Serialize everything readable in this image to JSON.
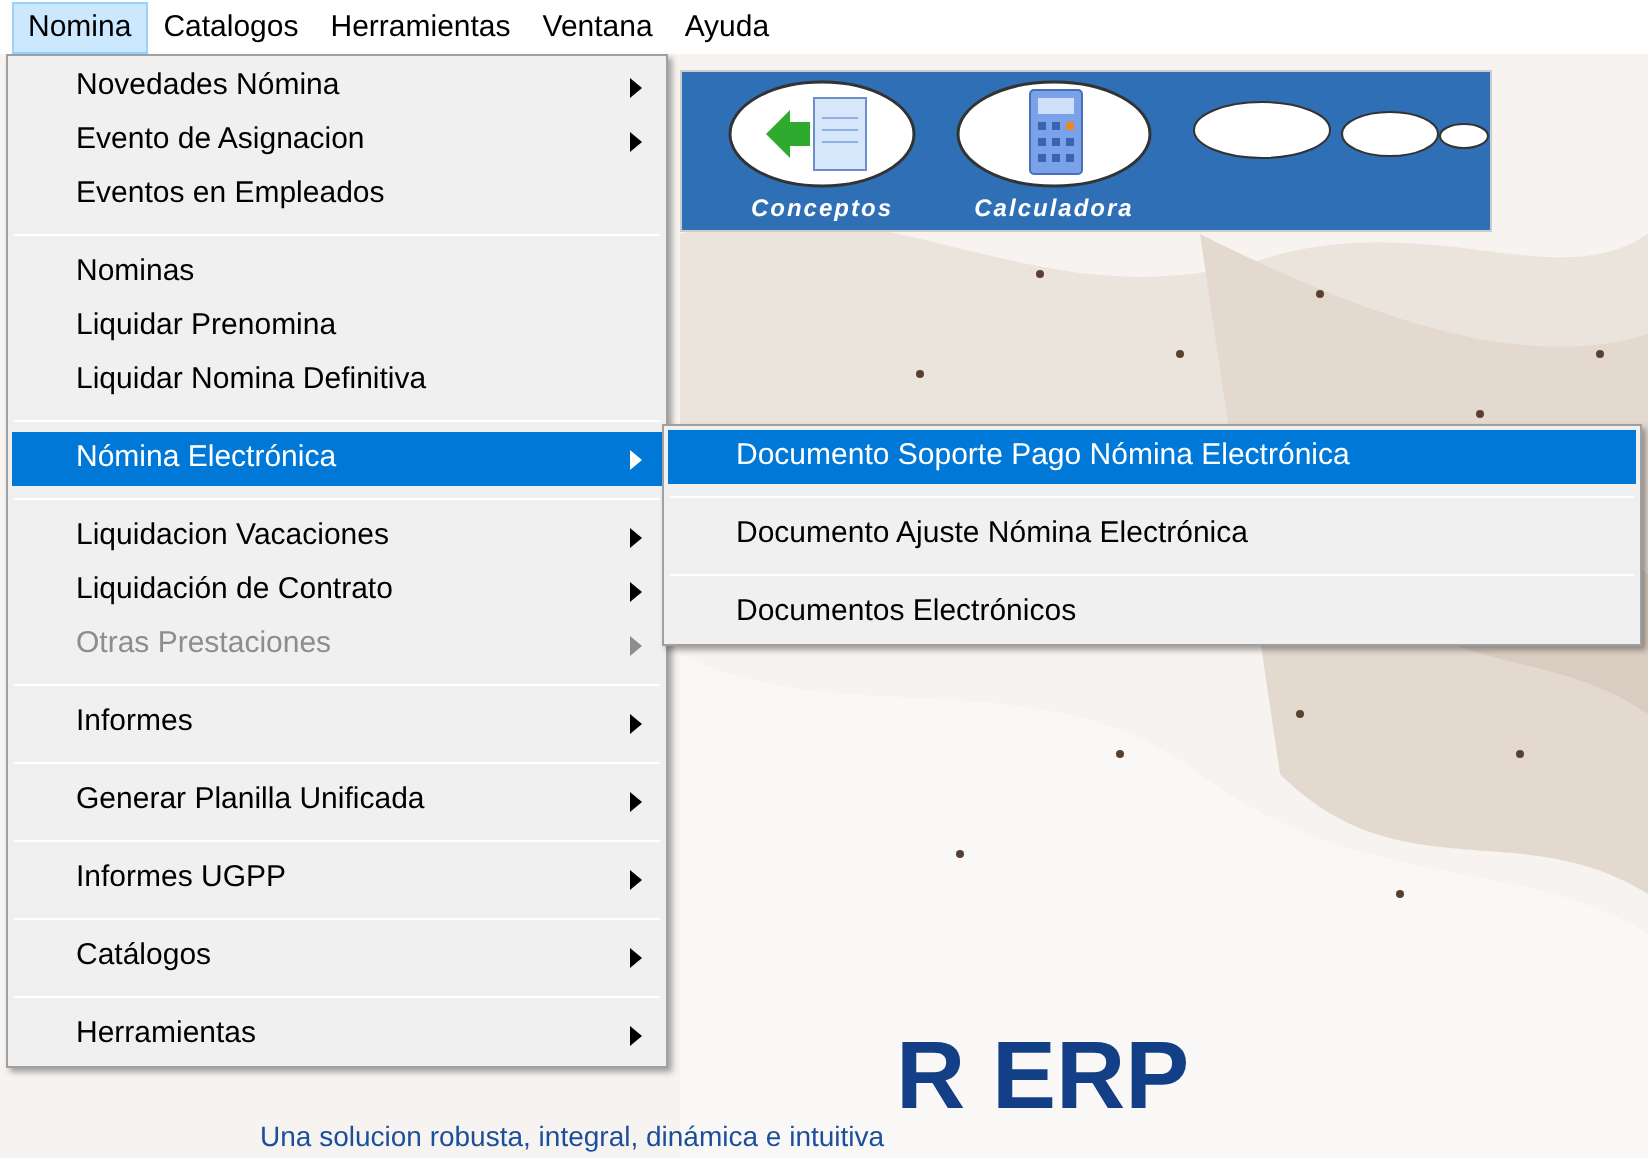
{
  "menubar": [
    {
      "label": "Nomina",
      "selected": true
    },
    {
      "label": "Catalogos",
      "selected": false
    },
    {
      "label": "Herramientas",
      "selected": false
    },
    {
      "label": "Ventana",
      "selected": false
    },
    {
      "label": "Ayuda",
      "selected": false
    }
  ],
  "toolbar": {
    "buttons": [
      {
        "label": "Conceptos",
        "kind": "concepts"
      },
      {
        "label": "Calculadora",
        "kind": "calculator"
      },
      {
        "kind": "blank"
      }
    ]
  },
  "menu": {
    "items": [
      {
        "kind": "item",
        "label": "Novedades Nómina",
        "submenu": true,
        "selected": false,
        "disabled": false
      },
      {
        "kind": "item",
        "label": "Evento de Asignacion",
        "submenu": true,
        "selected": false,
        "disabled": false
      },
      {
        "kind": "item",
        "label": "Eventos en Empleados",
        "submenu": false,
        "selected": false,
        "disabled": false
      },
      {
        "kind": "separator"
      },
      {
        "kind": "item",
        "label": "Nominas",
        "submenu": false,
        "selected": false,
        "disabled": false
      },
      {
        "kind": "item",
        "label": "Liquidar Prenomina",
        "submenu": false,
        "selected": false,
        "disabled": false
      },
      {
        "kind": "item",
        "label": "Liquidar Nomina Definitiva",
        "submenu": false,
        "selected": false,
        "disabled": false
      },
      {
        "kind": "separator"
      },
      {
        "kind": "item",
        "label": "Nómina Electrónica",
        "submenu": true,
        "selected": true,
        "disabled": false
      },
      {
        "kind": "separator"
      },
      {
        "kind": "item",
        "label": "Liquidacion Vacaciones",
        "submenu": true,
        "selected": false,
        "disabled": false
      },
      {
        "kind": "item",
        "label": "Liquidación de Contrato",
        "submenu": true,
        "selected": false,
        "disabled": false
      },
      {
        "kind": "item",
        "label": "Otras Prestaciones",
        "submenu": true,
        "selected": false,
        "disabled": true
      },
      {
        "kind": "separator"
      },
      {
        "kind": "item",
        "label": "Informes",
        "submenu": true,
        "selected": false,
        "disabled": false
      },
      {
        "kind": "separator"
      },
      {
        "kind": "item",
        "label": "Generar Planilla Unificada",
        "submenu": true,
        "selected": false,
        "disabled": false
      },
      {
        "kind": "separator"
      },
      {
        "kind": "item",
        "label": "Informes UGPP",
        "submenu": true,
        "selected": false,
        "disabled": false
      },
      {
        "kind": "separator"
      },
      {
        "kind": "item",
        "label": "Catálogos",
        "submenu": true,
        "selected": false,
        "disabled": false
      },
      {
        "kind": "separator"
      },
      {
        "kind": "item",
        "label": "Herramientas",
        "submenu": true,
        "selected": false,
        "disabled": false
      }
    ]
  },
  "submenu": {
    "items": [
      {
        "kind": "item",
        "label": "Documento Soporte Pago Nómina Electrónica",
        "selected": true
      },
      {
        "kind": "separator"
      },
      {
        "kind": "item",
        "label": "Documento Ajuste Nómina Electrónica",
        "selected": false
      },
      {
        "kind": "separator"
      },
      {
        "kind": "item",
        "label": "Documentos Electrónicos",
        "selected": false
      }
    ]
  },
  "logo": {
    "text": "R ERP",
    "tagline": "Una solucion robusta, integral, dinámica e intuitiva"
  }
}
